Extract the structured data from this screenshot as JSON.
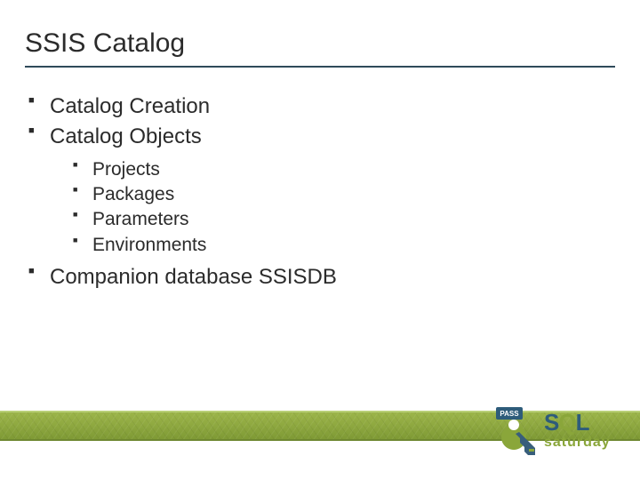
{
  "title": "SSIS Catalog",
  "bullets": [
    {
      "text": "Catalog Creation",
      "children": []
    },
    {
      "text": "Catalog Objects",
      "children": [
        {
          "text": "Projects"
        },
        {
          "text": "Packages"
        },
        {
          "text": "Parameters"
        },
        {
          "text": "Environments"
        }
      ]
    },
    {
      "text": "Companion database SSISDB",
      "children": []
    }
  ],
  "logo": {
    "pass_label": "PASS",
    "sql": "SQL",
    "saturday": "saturday"
  }
}
